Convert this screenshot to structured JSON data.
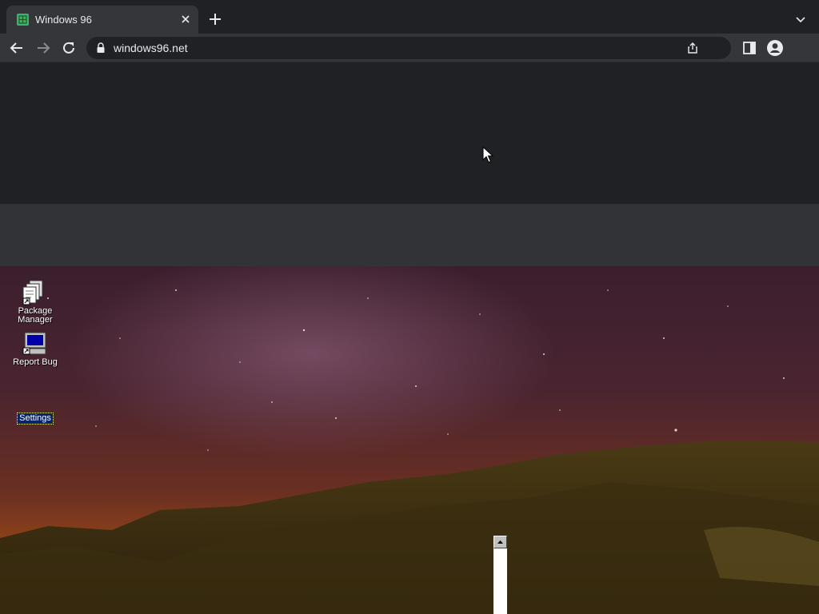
{
  "browser": {
    "tab": {
      "title": "Windows 96",
      "favicon": "windows96-logo-icon"
    },
    "url": "windows96.net",
    "icons": [
      "back-icon",
      "forward-icon",
      "reload-icon",
      "lock-icon",
      "share-icon",
      "side-panel-icon",
      "profile-icon",
      "new-tab-icon",
      "tab-list-icon",
      "close-icon"
    ]
  },
  "desktop": {
    "icons": [
      {
        "label": "Package Manager",
        "icon": "package-manager-icon"
      },
      {
        "label": "Report Bug",
        "icon": "report-bug-icon"
      },
      {
        "label": "Settings",
        "icon": "settings-icon",
        "selected": true
      }
    ]
  },
  "colors": {
    "chrome_bg": "#202124",
    "toolbar_bg": "#35363a",
    "band": "#323336",
    "selection": "#0a246a"
  }
}
